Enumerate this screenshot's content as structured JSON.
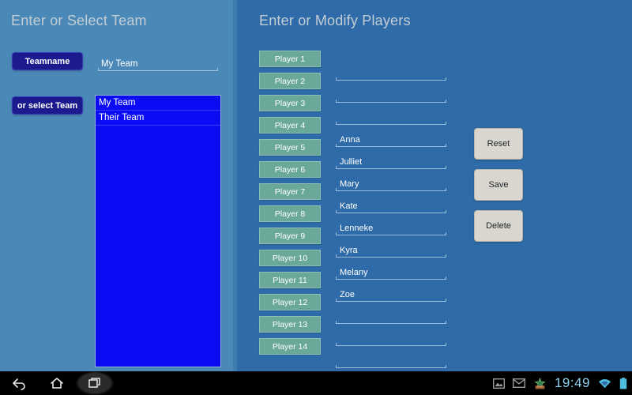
{
  "left_panel": {
    "title": "Enter or Select Team",
    "teamname_button": "Teamname",
    "teamname_value": "My Team",
    "teamname_placeholder": "",
    "select_team_button": "or select Team",
    "team_list": [
      "My Team",
      "Their Team"
    ]
  },
  "right_panel": {
    "title": "Enter or Modify Players",
    "players": [
      {
        "button": "Player 1",
        "name": ""
      },
      {
        "button": "Player 2",
        "name": ""
      },
      {
        "button": "Player 3",
        "name": ""
      },
      {
        "button": "Player 4",
        "name": "Anna"
      },
      {
        "button": "Player 5",
        "name": "Julliet"
      },
      {
        "button": "Player 6",
        "name": "Mary"
      },
      {
        "button": "Player 7",
        "name": "Kate"
      },
      {
        "button": "Player 8",
        "name": "Lenneke"
      },
      {
        "button": "Player 9",
        "name": "Kyra"
      },
      {
        "button": "Player 10",
        "name": "Melany"
      },
      {
        "button": "Player 11",
        "name": "Zoe"
      },
      {
        "button": "Player 12",
        "name": ""
      },
      {
        "button": "Player 13",
        "name": ""
      },
      {
        "button": "Player 14",
        "name": ""
      }
    ],
    "actions": [
      {
        "label": "Reset"
      },
      {
        "label": "Save"
      },
      {
        "label": "Delete"
      }
    ]
  },
  "system_bar": {
    "back_icon": "back-arrow-icon",
    "home_icon": "home-icon",
    "recent_icon": "recent-apps-icon",
    "screenshot_icon": "image-icon",
    "mail_icon": "mail-icon",
    "notification_icon": "notification-icon",
    "clock": "19:49",
    "wifi_icon": "wifi-icon",
    "battery_icon": "battery-icon"
  },
  "colors": {
    "panel_left_bg": "#4a88b8",
    "panel_right_bg": "#2e6ba8",
    "navy_button": "#1b1b8f",
    "player_button": "#6aa89a",
    "action_button": "#d8d6ce",
    "list_bg": "#0b0bf5",
    "title_text": "#c3cdd4",
    "clock_text": "#8fd3ee"
  }
}
